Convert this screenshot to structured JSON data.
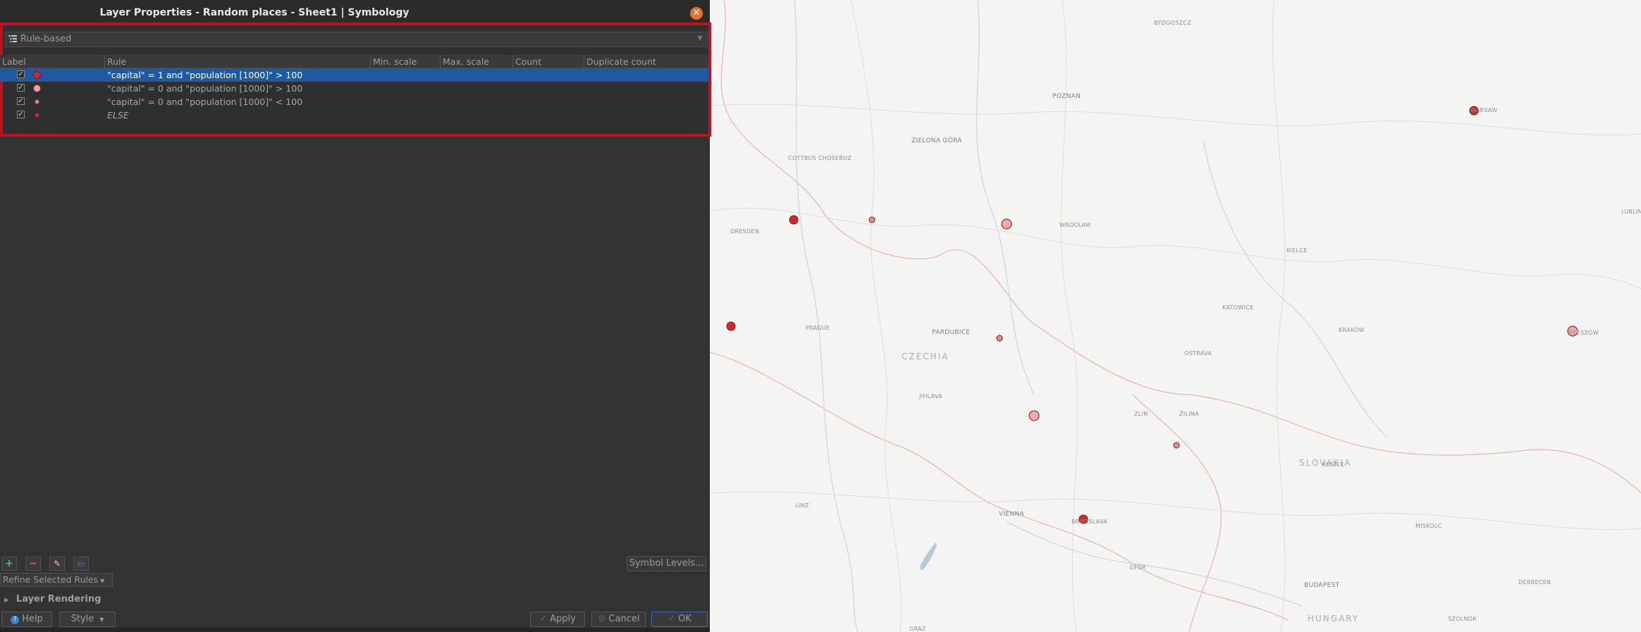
{
  "dialog": {
    "title": "Layer Properties - Random places - Sheet1 | Symbology",
    "close_icon": "close-icon",
    "renderer": "Rule-based",
    "columns": [
      "Label",
      "Rule",
      "Min. scale",
      "Max. scale",
      "Count",
      "Duplicate count"
    ],
    "rules": [
      {
        "checked": true,
        "rule": "\"capital\" = 1 and \"population [1000]\" > 100",
        "symbol_color": "#d7262a",
        "selected": true
      },
      {
        "checked": true,
        "rule": "\"capital\" = 0 and \"population [1000]\" > 100",
        "symbol_color": "#f0a0a0",
        "selected": false
      },
      {
        "checked": true,
        "rule": "\"capital\" = 0 and \"population [1000]\" < 100",
        "symbol_color": "#f08a8a",
        "selected": false
      },
      {
        "checked": true,
        "rule": "ELSE",
        "symbol_color": "#d7262a",
        "selected": false
      }
    ],
    "symbol_levels_label": "Symbol Levels...",
    "refine_label": "Refine Selected Rules",
    "layer_rendering_label": "Layer Rendering",
    "help_label": "Help",
    "style_label": "Style",
    "apply_label": "Apply",
    "cancel_label": "Cancel",
    "ok_label": "OK",
    "check_mark": "✓"
  },
  "map": {
    "labels": [
      {
        "text": "BYDGOSZCZ",
        "cls": ""
      },
      {
        "text": "POZNAŃ",
        "cls": "big"
      },
      {
        "text": "WARSAW",
        "cls": ""
      },
      {
        "text": "ZIELONA GÓRA",
        "cls": "big"
      },
      {
        "text": "COTTBUS CHÓŚEBUZ",
        "cls": ""
      },
      {
        "text": "DRESDEN",
        "cls": ""
      },
      {
        "text": "WROCŁAW",
        "cls": ""
      },
      {
        "text": "PARDUBICE",
        "cls": "big"
      },
      {
        "text": "CZECHIA",
        "cls": "country"
      },
      {
        "text": "JIHLAVA",
        "cls": ""
      },
      {
        "text": "OSTRAVA",
        "cls": ""
      },
      {
        "text": "KATOWICE",
        "cls": ""
      },
      {
        "text": "KRAKÓW",
        "cls": ""
      },
      {
        "text": "KIELCE",
        "cls": ""
      },
      {
        "text": "RZESZÓW",
        "cls": ""
      },
      {
        "text": "ŽILINA",
        "cls": ""
      },
      {
        "text": "SLOVAKIA",
        "cls": "country"
      },
      {
        "text": "VIENNA",
        "cls": "big"
      },
      {
        "text": "BRATISLAVA",
        "cls": ""
      },
      {
        "text": "GYŐR",
        "cls": ""
      },
      {
        "text": "BUDAPEST",
        "cls": "big"
      },
      {
        "text": "HUNGARY",
        "cls": "country"
      },
      {
        "text": "KOŠICE",
        "cls": ""
      },
      {
        "text": "MISKOLC",
        "cls": ""
      },
      {
        "text": "DEBRECEN",
        "cls": ""
      },
      {
        "text": "LINZ",
        "cls": ""
      },
      {
        "text": "ZLÍN",
        "cls": ""
      },
      {
        "text": "GRAZ",
        "cls": ""
      },
      {
        "text": "LUBLIN",
        "cls": ""
      },
      {
        "text": "PRAGUE",
        "cls": ""
      },
      {
        "text": "SZOLNOK",
        "cls": ""
      }
    ]
  }
}
